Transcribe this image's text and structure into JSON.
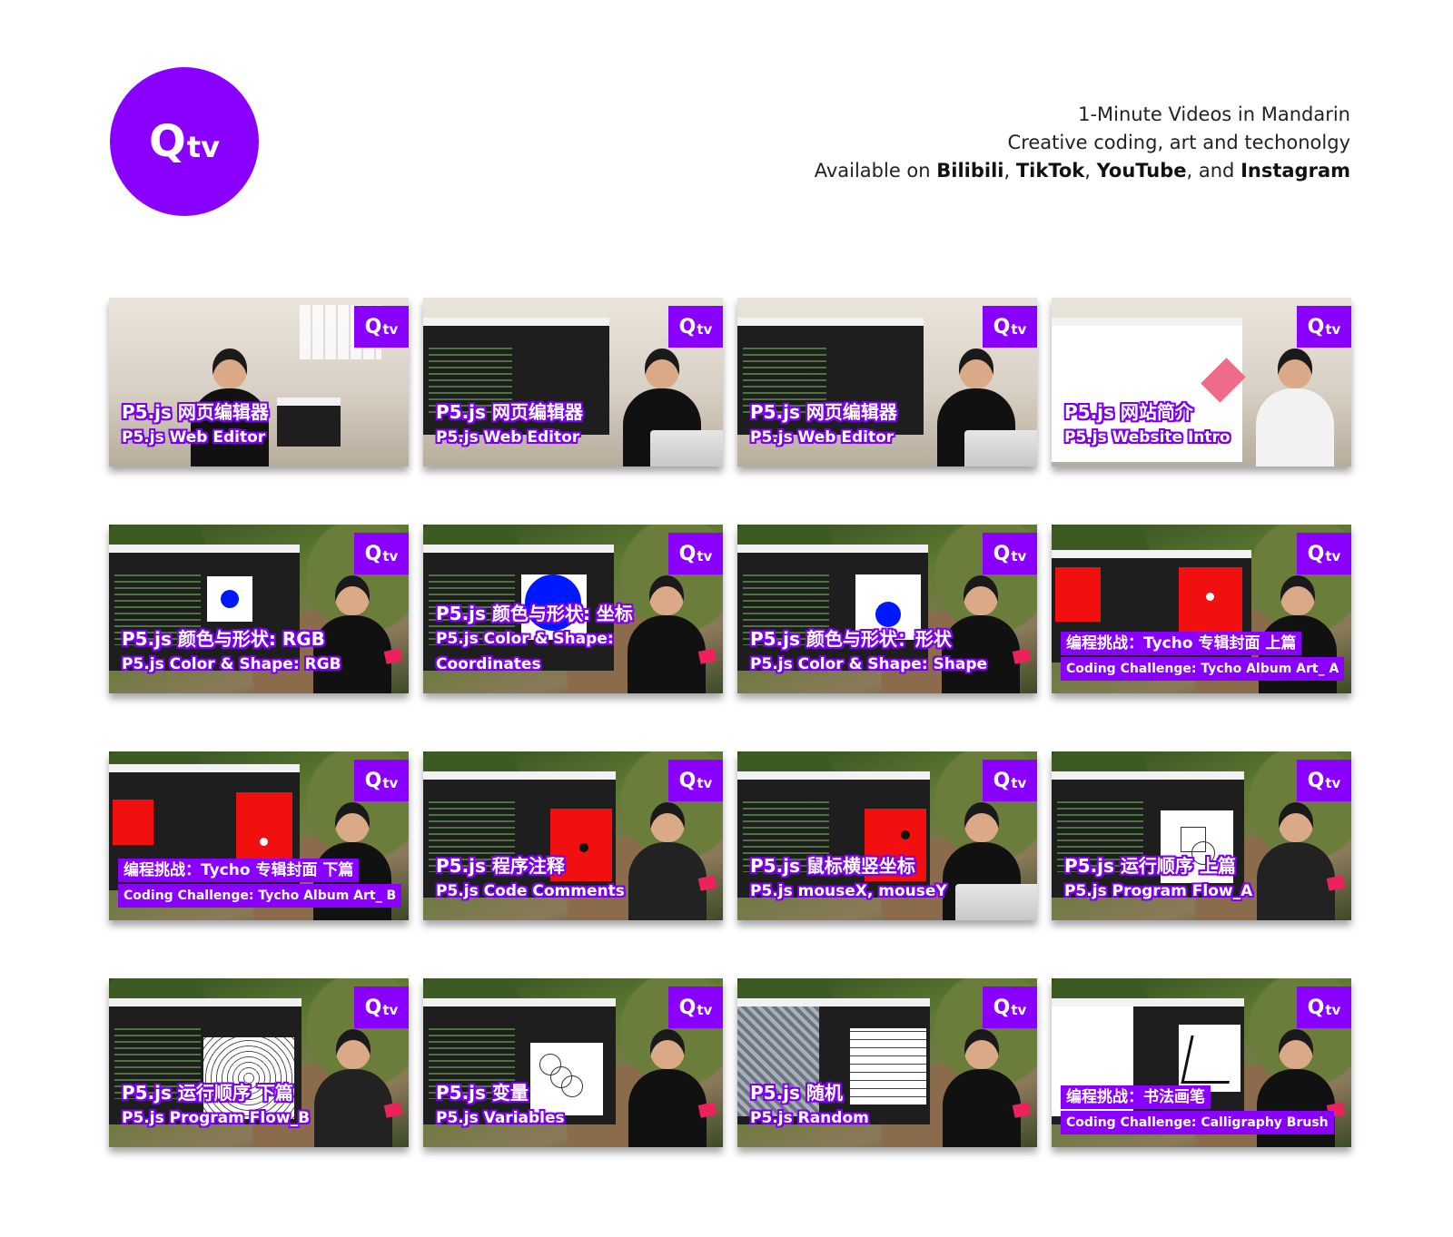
{
  "brand": {
    "logo_q": "Q",
    "logo_tv": "tv",
    "accent": "#8a00ff"
  },
  "tagline": {
    "line1": "1-Minute Videos in Mandarin",
    "line2": "Creative coding, art and techonolgy",
    "line3_prefix": "Available on ",
    "platform1": "Bilibili",
    "sep1": ", ",
    "platform2": "TikTok",
    "sep2": ", ",
    "platform3": "YouTube",
    "sep3": ", and ",
    "platform4": "Instagram"
  },
  "videos": [
    {
      "zh": "P5.js 网页编辑器",
      "en": "P5.js Web Editor"
    },
    {
      "zh": "P5.js 网页编辑器",
      "en": "P5.js Web Editor"
    },
    {
      "zh": "P5.js 网页编辑器",
      "en": "P5.js Web Editor"
    },
    {
      "zh": "P5.js 网站简介",
      "en": "P5.js Website Intro"
    },
    {
      "zh": "P5.js 颜色与形状: RGB",
      "en": "P5.js Color & Shape: RGB"
    },
    {
      "zh": "P5.js 颜色与形状: 坐标",
      "en": "P5.js Color & Shape: Coordinates"
    },
    {
      "zh": "P5.js 颜色与形状：形状",
      "en": "P5.js Color & Shape: Shape"
    },
    {
      "zh": "编程挑战：Tycho 专辑封面 上篇",
      "en": "Coding Challenge: Tycho Album Art_ A"
    },
    {
      "zh": "编程挑战：Tycho 专辑封面 下篇",
      "en": "Coding Challenge: Tycho Album Art_ B"
    },
    {
      "zh": "P5.js 程序注释",
      "en": "P5.js Code Comments"
    },
    {
      "zh": "P5.js 鼠标横竖坐标",
      "en": "P5.js mouseX, mouseY"
    },
    {
      "zh": "P5.js 运行顺序 上篇",
      "en": "P5.js Program Flow_A"
    },
    {
      "zh": "P5.js 运行顺序 下篇",
      "en": "P5.js Program Flow_B"
    },
    {
      "zh": "P5.js 变量",
      "en": "P5.js Variables"
    },
    {
      "zh": "P5.js 随机",
      "en": "P5.js Random"
    },
    {
      "zh": "编程挑战：书法画笔",
      "en": "Coding Challenge: Calligraphy Brush"
    }
  ]
}
